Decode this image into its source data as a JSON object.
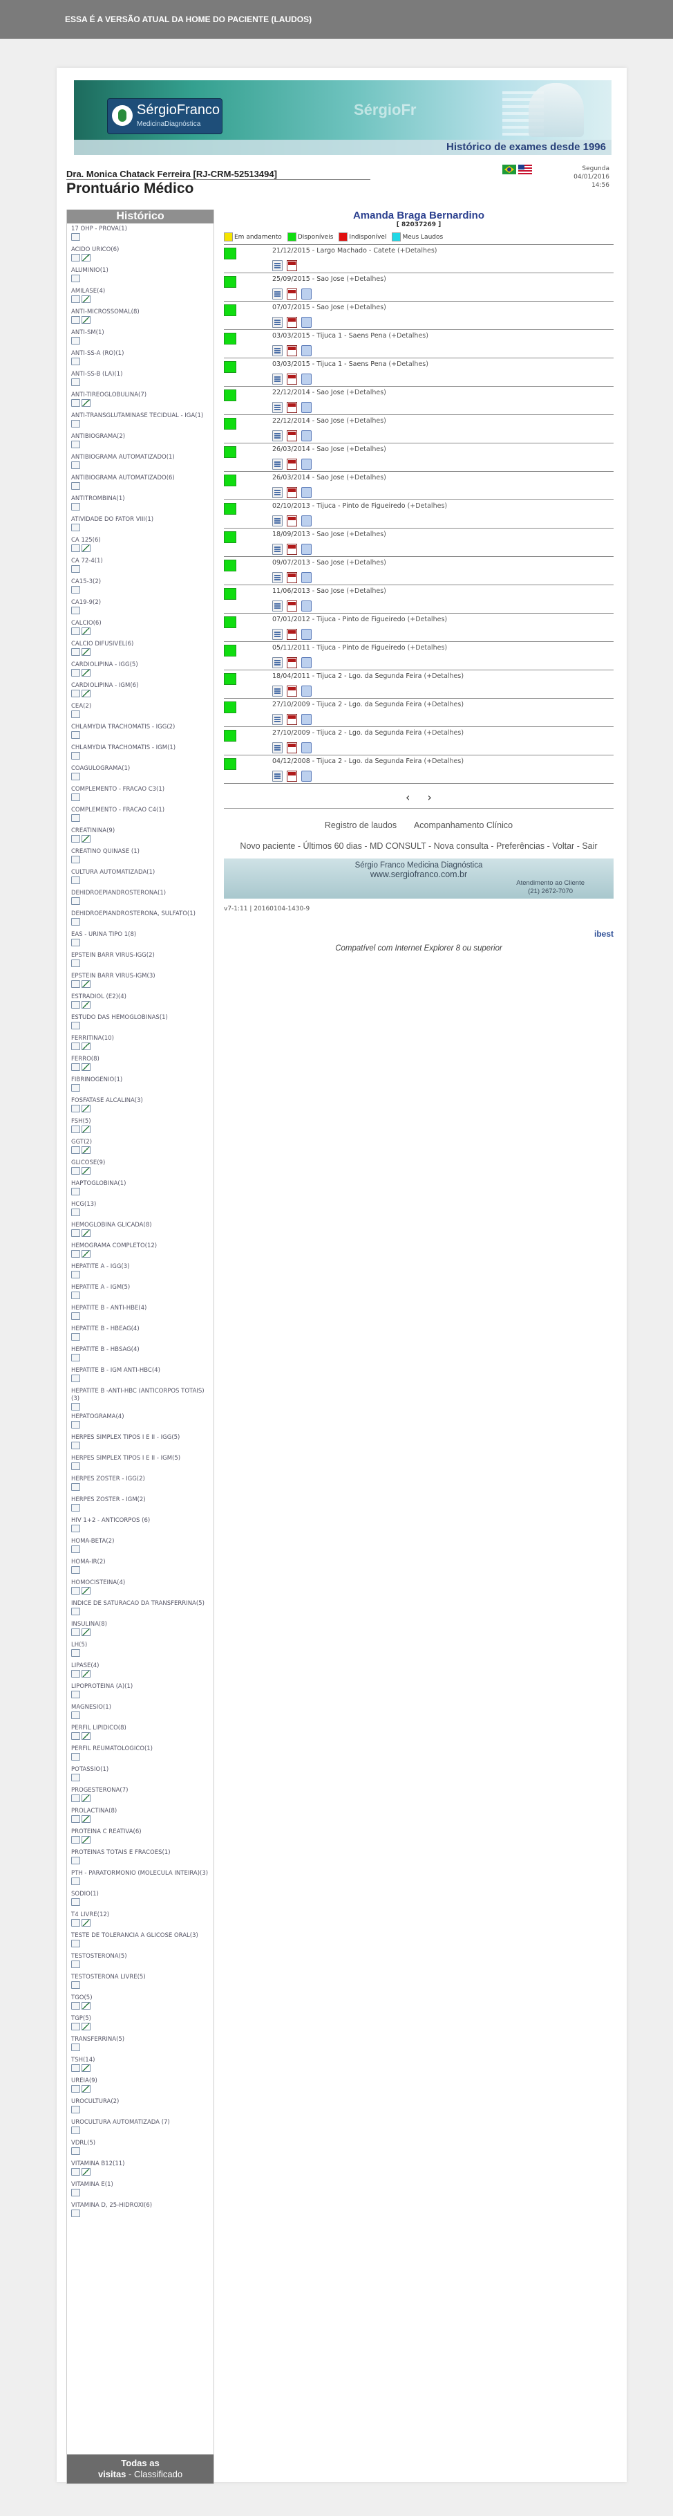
{
  "top_banner": {
    "text": "ESSA É A VERSÃO ATUAL DA HOME DO PACIENTE (LAUDOS)"
  },
  "header": {
    "brand": "SérgioFranco",
    "brand_sub": "MedicinaDiagnóstica",
    "brand_ghost": "SérgioFr",
    "tagline": "Histórico de exames desde 1996",
    "doctor": "Dra. Monica Chatack Ferreira [RJ-CRM-52513494]",
    "title": "Prontuário Médico",
    "weekday": "Segunda",
    "date": "04/01/2016",
    "time": "14:56"
  },
  "sidebar": {
    "heading": "Histórico",
    "footer_line1": "Todas as",
    "footer_line2_bold": "visitas",
    "footer_line2_rest": " - Classificado",
    "items": [
      {
        "name": "17 OHP - PROVA(1)",
        "graph": false
      },
      {
        "name": "ACIDO URICO(6)",
        "graph": true
      },
      {
        "name": "ALUMINIO(1)",
        "graph": false
      },
      {
        "name": "AMILASE(4)",
        "graph": true
      },
      {
        "name": "ANTI-MICROSSOMAL(8)",
        "graph": true
      },
      {
        "name": "ANTI-SM(1)",
        "graph": false
      },
      {
        "name": "ANTI-SS-A (RO)(1)",
        "graph": false
      },
      {
        "name": "ANTI-SS-B (LA)(1)",
        "graph": false
      },
      {
        "name": "ANTI-TIREOGLOBULINA(7)",
        "graph": true
      },
      {
        "name": "ANTI-TRANSGLUTAMINASE TECIDUAL - IGA(1)",
        "graph": false
      },
      {
        "name": "ANTIBIOGRAMA(2)",
        "graph": false
      },
      {
        "name": "ANTIBIOGRAMA AUTOMATIZADO(1)",
        "graph": false
      },
      {
        "name": "ANTIBIOGRAMA AUTOMATIZADO(6)",
        "graph": false
      },
      {
        "name": "ANTITROMBINA(1)",
        "graph": false
      },
      {
        "name": "ATIVIDADE DO FATOR VIII(1)",
        "graph": false
      },
      {
        "name": "CA 125(6)",
        "graph": true
      },
      {
        "name": "CA 72-4(1)",
        "graph": false
      },
      {
        "name": "CA15-3(2)",
        "graph": false
      },
      {
        "name": "CA19-9(2)",
        "graph": false
      },
      {
        "name": "CALCIO(6)",
        "graph": true
      },
      {
        "name": "CALCIO DIFUSIVEL(6)",
        "graph": true
      },
      {
        "name": "CARDIOLIPINA - IGG(5)",
        "graph": true
      },
      {
        "name": "CARDIOLIPINA - IGM(6)",
        "graph": true
      },
      {
        "name": "CEA(2)",
        "graph": false
      },
      {
        "name": "CHLAMYDIA TRACHOMATIS - IGG(2)",
        "graph": false
      },
      {
        "name": "CHLAMYDIA TRACHOMATIS - IGM(1)",
        "graph": false
      },
      {
        "name": "COAGULOGRAMA(1)",
        "graph": false
      },
      {
        "name": "COMPLEMENTO - FRACAO C3(1)",
        "graph": false
      },
      {
        "name": "COMPLEMENTO - FRACAO C4(1)",
        "graph": false
      },
      {
        "name": "CREATININA(9)",
        "graph": true
      },
      {
        "name": "CREATINO QUINASE (1)",
        "graph": false
      },
      {
        "name": "CULTURA AUTOMATIZADA(1)",
        "graph": false
      },
      {
        "name": "DEHIDROEPIANDROSTERONA(1)",
        "graph": false
      },
      {
        "name": "DEHIDROEPIANDROSTERONA, SULFATO(1)",
        "graph": false
      },
      {
        "name": "EAS - URINA TIPO 1(8)",
        "graph": false
      },
      {
        "name": "EPSTEIN BARR VIRUS-IGG(2)",
        "graph": false
      },
      {
        "name": "EPSTEIN BARR VIRUS-IGM(3)",
        "graph": true
      },
      {
        "name": "ESTRADIOL (E2)(4)",
        "graph": true
      },
      {
        "name": "ESTUDO DAS HEMOGLOBINAS(1)",
        "graph": false
      },
      {
        "name": "FERRITINA(10)",
        "graph": true
      },
      {
        "name": "FERRO(8)",
        "graph": true
      },
      {
        "name": "FIBRINOGENIO(1)",
        "graph": false
      },
      {
        "name": "FOSFATASE ALCALINA(3)",
        "graph": true
      },
      {
        "name": "FSH(5)",
        "graph": true
      },
      {
        "name": "GGT(2)",
        "graph": true
      },
      {
        "name": "GLICOSE(9)",
        "graph": true
      },
      {
        "name": "HAPTOGLOBINA(1)",
        "graph": false
      },
      {
        "name": "HCG(13)",
        "graph": false
      },
      {
        "name": "HEMOGLOBINA GLICADA(8)",
        "graph": true
      },
      {
        "name": "HEMOGRAMA COMPLETO(12)",
        "graph": true
      },
      {
        "name": "HEPATITE A - IGG(3)",
        "graph": false
      },
      {
        "name": "HEPATITE A - IGM(5)",
        "graph": false
      },
      {
        "name": "HEPATITE B - ANTI-HBE(4)",
        "graph": false
      },
      {
        "name": "HEPATITE B - HBEAG(4)",
        "graph": false
      },
      {
        "name": "HEPATITE B - HBSAG(4)",
        "graph": false
      },
      {
        "name": "HEPATITE B - IGM ANTI-HBC(4)",
        "graph": false
      },
      {
        "name": "HEPATITE B -ANTI-HBC (ANTICORPOS TOTAIS)(3)",
        "graph": false
      },
      {
        "name": "HEPATOGRAMA(4)",
        "graph": false
      },
      {
        "name": "HERPES SIMPLEX TIPOS I E II - IGG(5)",
        "graph": false
      },
      {
        "name": "HERPES SIMPLEX TIPOS I E II - IGM(5)",
        "graph": false
      },
      {
        "name": "HERPES ZOSTER - IGG(2)",
        "graph": false
      },
      {
        "name": "HERPES ZOSTER - IGM(2)",
        "graph": false
      },
      {
        "name": "HIV 1+2 - ANTICORPOS (6)",
        "graph": false
      },
      {
        "name": "HOMA-BETA(2)",
        "graph": false
      },
      {
        "name": "HOMA-IR(2)",
        "graph": false
      },
      {
        "name": "HOMOCISTEINA(4)",
        "graph": true
      },
      {
        "name": "INDICE DE SATURACAO DA TRANSFERRINA(5)",
        "graph": false
      },
      {
        "name": "INSULINA(8)",
        "graph": true
      },
      {
        "name": "LH(5)",
        "graph": false
      },
      {
        "name": "LIPASE(4)",
        "graph": true
      },
      {
        "name": "LIPOPROTEINA (A)(1)",
        "graph": false
      },
      {
        "name": "MAGNESIO(1)",
        "graph": false
      },
      {
        "name": "PERFIL LIPIDICO(8)",
        "graph": true
      },
      {
        "name": "PERFIL REUMATOLOGICO(1)",
        "graph": false
      },
      {
        "name": "POTASSIO(1)",
        "graph": false
      },
      {
        "name": "PROGESTERONA(7)",
        "graph": true
      },
      {
        "name": "PROLACTINA(8)",
        "graph": true
      },
      {
        "name": "PROTEINA C REATIVA(6)",
        "graph": true
      },
      {
        "name": "PROTEINAS TOTAIS E FRACOES(1)",
        "graph": false
      },
      {
        "name": "PTH - PARATORMONIO (MOLECULA INTEIRA)(3)",
        "graph": false
      },
      {
        "name": "SODIO(1)",
        "graph": false
      },
      {
        "name": "T4 LIVRE(12)",
        "graph": true
      },
      {
        "name": "TESTE DE TOLERANCIA A GLICOSE ORAL(3)",
        "graph": false
      },
      {
        "name": "TESTOSTERONA(5)",
        "graph": false
      },
      {
        "name": "TESTOSTERONA LIVRE(5)",
        "graph": false
      },
      {
        "name": "TGO(5)",
        "graph": true
      },
      {
        "name": "TGP(5)",
        "graph": true
      },
      {
        "name": "TRANSFERRINA(5)",
        "graph": false
      },
      {
        "name": "TSH(14)",
        "graph": true
      },
      {
        "name": "UREIA(9)",
        "graph": true
      },
      {
        "name": "UROCULTURA(2)",
        "graph": false
      },
      {
        "name": "UROCULTURA AUTOMATIZADA (7)",
        "graph": false
      },
      {
        "name": "VDRL(5)",
        "graph": false
      },
      {
        "name": "VITAMINA B12(11)",
        "graph": true
      },
      {
        "name": "VITAMINA E(1)",
        "graph": false
      },
      {
        "name": "VITAMINA D, 25-HIDROXI(6)",
        "graph": false
      }
    ]
  },
  "patient": {
    "name": "Amanda Braga Bernardino",
    "id": "[ 82037269 ]"
  },
  "legend": [
    {
      "label": "Em andamento",
      "color": "#f5e400"
    },
    {
      "label": "Disponíveis",
      "color": "#10dd10"
    },
    {
      "label": "Indisponível",
      "color": "#e01010"
    },
    {
      "label": "Meus Laudos",
      "color": "#20d8e6"
    }
  ],
  "visits": [
    {
      "date": "21/12/2015",
      "place": "Largo Machado - Catete",
      "details": "(+Detalhes)",
      "blue": false
    },
    {
      "date": "25/09/2015",
      "place": "Sao Jose",
      "details": "(+Detalhes)",
      "blue": true
    },
    {
      "date": "07/07/2015",
      "place": "Sao Jose",
      "details": "(+Detalhes)",
      "blue": true
    },
    {
      "date": "03/03/2015",
      "place": "Tijuca 1 - Saens Pena",
      "details": "(+Detalhes)",
      "blue": true
    },
    {
      "date": "03/03/2015",
      "place": "Tijuca 1 - Saens Pena",
      "details": "(+Detalhes)",
      "blue": true
    },
    {
      "date": "22/12/2014",
      "place": "Sao Jose",
      "details": "(+Detalhes)",
      "blue": true
    },
    {
      "date": "22/12/2014",
      "place": "Sao Jose",
      "details": "(+Detalhes)",
      "blue": true
    },
    {
      "date": "26/03/2014",
      "place": "Sao Jose",
      "details": "(+Detalhes)",
      "blue": true
    },
    {
      "date": "26/03/2014",
      "place": "Sao Jose",
      "details": "(+Detalhes)",
      "blue": true
    },
    {
      "date": "02/10/2013",
      "place": "Tijuca - Pinto de Figueiredo",
      "details": "(+Detalhes)",
      "blue": true
    },
    {
      "date": "18/09/2013",
      "place": "Sao Jose",
      "details": "(+Detalhes)",
      "blue": true
    },
    {
      "date": "09/07/2013",
      "place": "Sao Jose",
      "details": "(+Detalhes)",
      "blue": true
    },
    {
      "date": "11/06/2013",
      "place": "Sao Jose",
      "details": "(+Detalhes)",
      "blue": true
    },
    {
      "date": "07/01/2012",
      "place": "Tijuca - Pinto de Figueiredo",
      "details": "(+Detalhes)",
      "blue": true
    },
    {
      "date": "05/11/2011",
      "place": "Tijuca - Pinto de Figueiredo",
      "details": "(+Detalhes)",
      "blue": true
    },
    {
      "date": "18/04/2011",
      "place": "Tijuca 2 - Lgo. da Segunda Feira",
      "details": "(+Detalhes)",
      "blue": true
    },
    {
      "date": "27/10/2009",
      "place": "Tijuca 2 - Lgo. da Segunda Feira",
      "details": "(+Detalhes)",
      "blue": true
    },
    {
      "date": "27/10/2009",
      "place": "Tijuca 2 - Lgo. da Segunda Feira",
      "details": "(+Detalhes)",
      "blue": true
    },
    {
      "date": "04/12/2008",
      "place": "Tijuca 2 - Lgo. da Segunda Feira",
      "details": "(+Detalhes)",
      "blue": true
    }
  ],
  "pager": {
    "prev": "‹",
    "next": "›"
  },
  "links": {
    "registro": "Registro de laudos",
    "acompanhamento": "Acompanhamento Clínico",
    "novo": "Novo paciente",
    "ultimos": "Últimos 60 dias",
    "md_consult": "MD CONSULT",
    "nova": "Nova consulta",
    "preferencias": "Preferências",
    "voltar": "Voltar",
    "sair": "Sair"
  },
  "footer": {
    "company": "Sérgio Franco Medicina Diagnóstica",
    "site": "www.sergiofranco.com.br",
    "service": "Atendimento ao Cliente",
    "phone": "(21) 2672-7070",
    "version": "v7-1:11 | 20160104-1430-9",
    "ibest": "ibest",
    "compat": "Compatível com Internet Explorer 8 ou superior"
  }
}
